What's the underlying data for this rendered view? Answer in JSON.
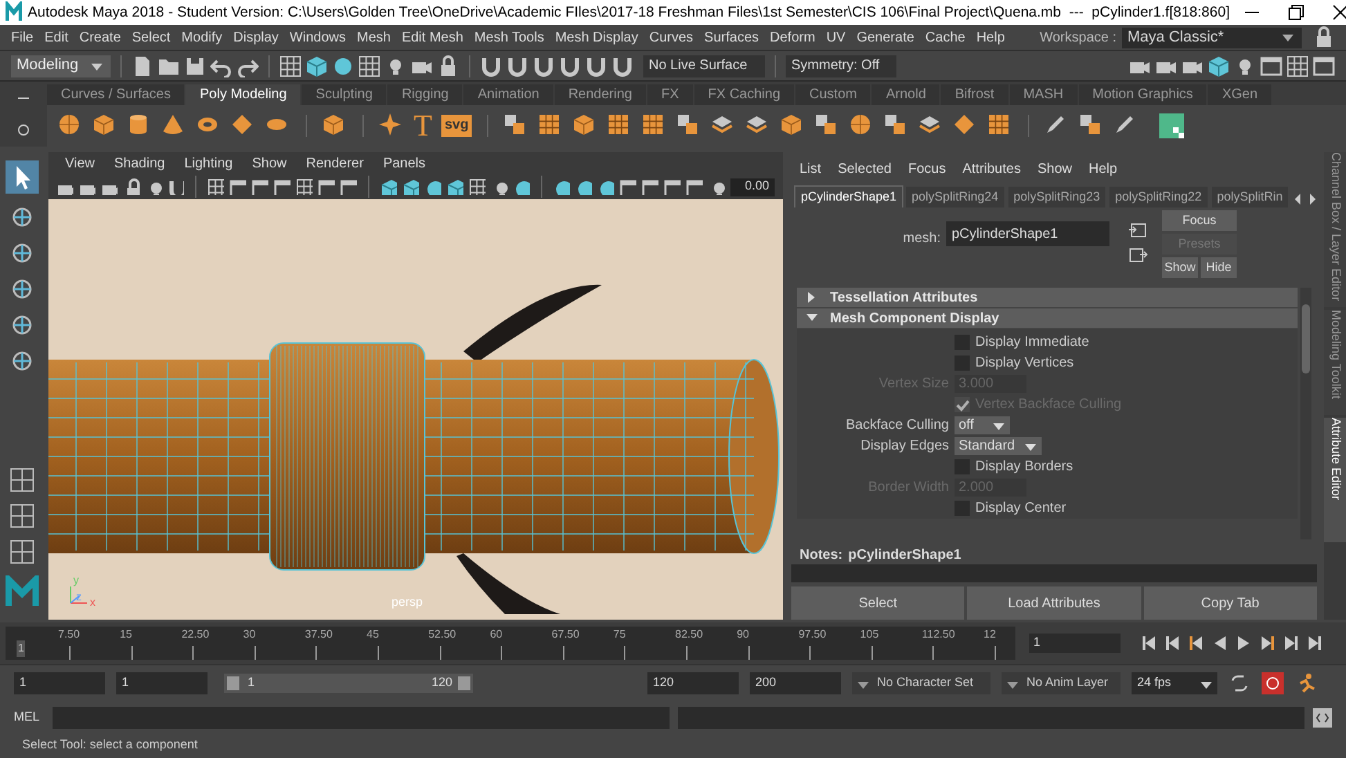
{
  "title_bar": {
    "title": "Autodesk Maya 2018 - Student Version: C:\\Users\\Golden Tree\\OneDrive\\Academic FIles\\2017-18 Freshman Files\\1st Semester\\CIS 106\\Final Project\\Quena.mb  ---  pCylinder1.f[818:860]"
  },
  "menu_bar": {
    "items": [
      "File",
      "Edit",
      "Create",
      "Select",
      "Modify",
      "Display",
      "Windows",
      "Mesh",
      "Edit Mesh",
      "Mesh Tools",
      "Mesh Display",
      "Curves",
      "Surfaces",
      "Deform",
      "UV",
      "Generate",
      "Cache",
      "Help"
    ],
    "workspace_label": "Workspace :",
    "workspace": "Maya Classic*"
  },
  "status_line": {
    "mode": "Modeling",
    "live_surface": "No Live Surface",
    "symmetry": "Symmetry: Off"
  },
  "shelf": {
    "tabs": [
      {
        "label": "Curves / Surfaces",
        "selected": false
      },
      {
        "label": "Poly Modeling",
        "selected": true
      },
      {
        "label": "Sculpting",
        "selected": false
      },
      {
        "label": "Rigging",
        "selected": false
      },
      {
        "label": "Animation",
        "selected": false
      },
      {
        "label": "Rendering",
        "selected": false
      },
      {
        "label": "FX",
        "selected": false
      },
      {
        "label": "FX Caching",
        "selected": false
      },
      {
        "label": "Custom",
        "selected": false
      },
      {
        "label": "Arnold",
        "selected": false
      },
      {
        "label": "Bifrost",
        "selected": false
      },
      {
        "label": "MASH",
        "selected": false
      },
      {
        "label": "Motion Graphics",
        "selected": false
      },
      {
        "label": "XGen",
        "selected": false
      }
    ],
    "text_icons": [
      "T",
      "svg"
    ]
  },
  "viewport": {
    "menu": [
      "View",
      "Shading",
      "Lighting",
      "Show",
      "Renderer",
      "Panels"
    ],
    "exposure": "0.00",
    "camera": "persp",
    "axes": [
      "y",
      "z",
      "x"
    ]
  },
  "attribute_editor": {
    "menu": [
      "List",
      "Selected",
      "Focus",
      "Attributes",
      "Show",
      "Help"
    ],
    "tabs": [
      {
        "label": "pCylinderShape1",
        "selected": true
      },
      {
        "label": "polySplitRing24",
        "selected": false
      },
      {
        "label": "polySplitRing23",
        "selected": false
      },
      {
        "label": "polySplitRing22",
        "selected": false
      },
      {
        "label": "polySplitRin",
        "selected": false
      }
    ],
    "node_label": "mesh:",
    "node_value": "pCylinderShape1",
    "buttons": [
      {
        "label": "Focus",
        "disabled": false
      },
      {
        "label": "Presets",
        "disabled": true
      },
      {
        "label": "Show",
        "disabled": false
      },
      {
        "label": "Hide",
        "disabled": false
      }
    ],
    "sections": [
      {
        "title": "Tessellation Attributes",
        "expanded": false
      },
      {
        "title": "Mesh Component Display",
        "expanded": true
      }
    ],
    "rows": [
      {
        "kind": "checkbox",
        "label": "Display Immediate",
        "checked": false,
        "disabled": false
      },
      {
        "kind": "checkbox",
        "label": "Display Vertices",
        "checked": false,
        "disabled": false
      },
      {
        "kind": "field",
        "label": "Vertex Size",
        "value": "3.000",
        "disabled": true
      },
      {
        "kind": "checkbox",
        "label": "Vertex Backface Culling",
        "checked": true,
        "disabled": true
      },
      {
        "kind": "dropdown",
        "label": "Backface Culling",
        "value": "off",
        "disabled": false
      },
      {
        "kind": "dropdown",
        "label": "Display Edges",
        "value": "Standard",
        "disabled": false
      },
      {
        "kind": "checkbox",
        "label": "Display Borders",
        "checked": false,
        "disabled": false
      },
      {
        "kind": "field",
        "label": "Border Width",
        "value": "2.000",
        "disabled": true
      },
      {
        "kind": "checkbox",
        "label": "Display Center",
        "checked": false,
        "disabled": false
      }
    ],
    "notes_label": "Notes:",
    "notes_node": "pCylinderShape1",
    "bottom_buttons": [
      "Select",
      "Load Attributes",
      "Copy Tab"
    ]
  },
  "side_tabs": [
    {
      "label": "Channel Box / Layer Editor",
      "selected": false
    },
    {
      "label": "Modeling Toolkit",
      "selected": false
    },
    {
      "label": "Attribute Editor",
      "selected": true
    }
  ],
  "timeline": {
    "start_marker": "1",
    "ticks": [
      "7.50",
      "15",
      "22.50",
      "30",
      "37.50",
      "45",
      "52.50",
      "60",
      "67.50",
      "75",
      "82.50",
      "90",
      "97.50",
      "105",
      "112.50",
      "12"
    ],
    "current_frame": "1"
  },
  "range": {
    "level": 1,
    "start": "1",
    "playback_start": "1",
    "slider_min": "1",
    "slider_max": "120",
    "playback_end": "120",
    "end": "200",
    "character_set": "No Character Set",
    "anim_layer": "No Anim Layer",
    "fps": "24 fps"
  },
  "command_line": {
    "language": "MEL"
  },
  "help_line": "Select Tool: select a component"
}
